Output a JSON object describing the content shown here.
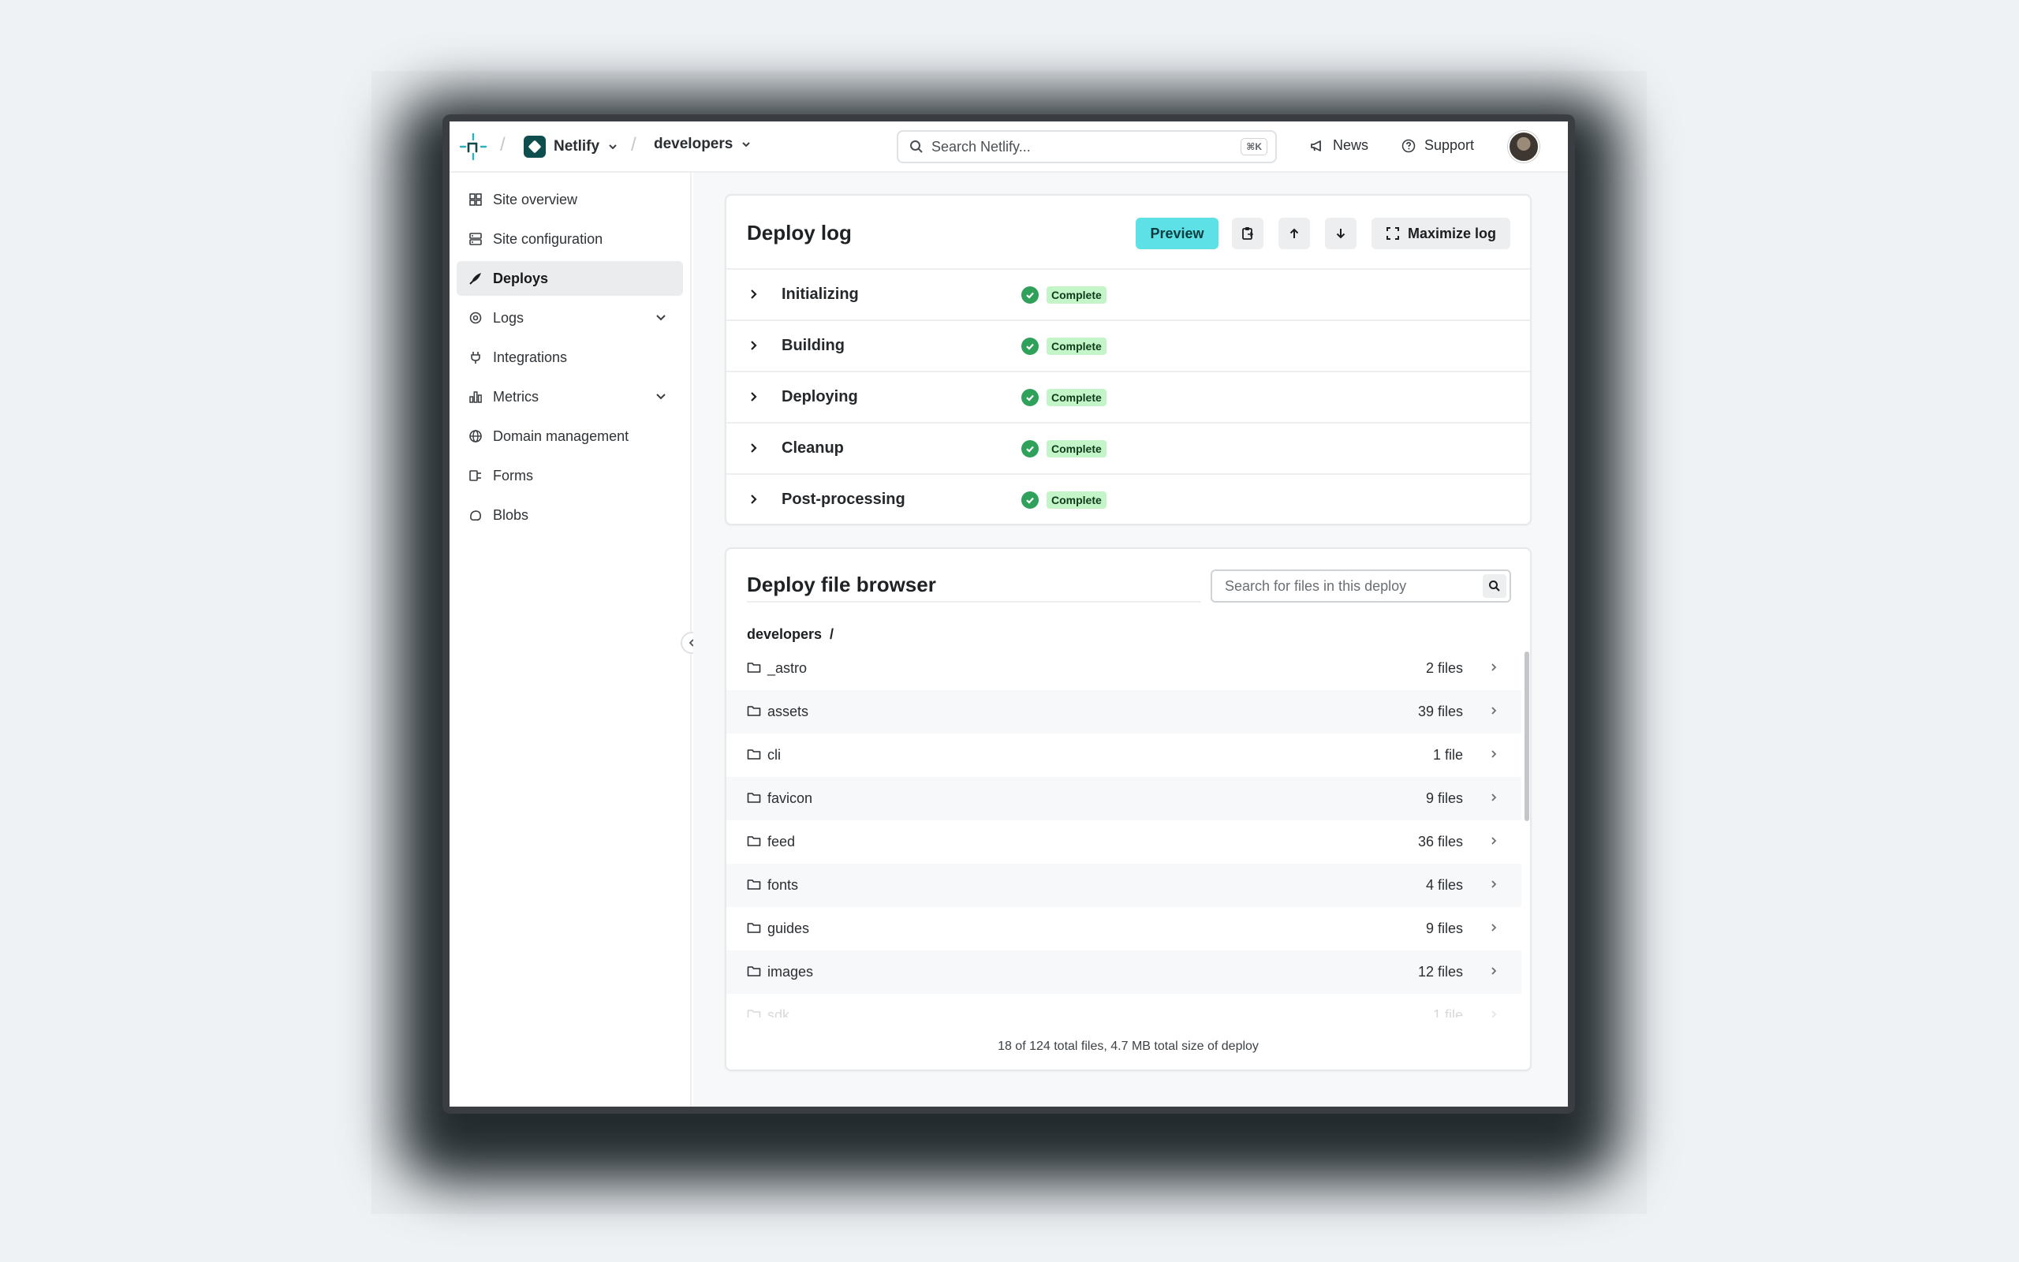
{
  "header": {
    "team_name": "Netlify",
    "site_name": "developers",
    "search_placeholder": "Search Netlify...",
    "search_shortcut": "⌘K",
    "news_label": "News",
    "support_label": "Support"
  },
  "sidebar": {
    "items": [
      {
        "label": "Site overview",
        "icon": "grid-icon"
      },
      {
        "label": "Site configuration",
        "icon": "config-icon"
      },
      {
        "label": "Deploys",
        "icon": "rocket-icon",
        "active": true
      },
      {
        "label": "Logs",
        "icon": "logs-icon",
        "expandable": true
      },
      {
        "label": "Integrations",
        "icon": "plug-icon"
      },
      {
        "label": "Metrics",
        "icon": "chart-icon",
        "expandable": true
      },
      {
        "label": "Domain management",
        "icon": "globe-icon"
      },
      {
        "label": "Forms",
        "icon": "form-icon"
      },
      {
        "label": "Blobs",
        "icon": "blob-icon"
      }
    ]
  },
  "deploy_log": {
    "title": "Deploy log",
    "preview_label": "Preview",
    "maximize_label": "Maximize log",
    "steps": [
      {
        "name": "Initializing",
        "status": "Complete"
      },
      {
        "name": "Building",
        "status": "Complete"
      },
      {
        "name": "Deploying",
        "status": "Complete"
      },
      {
        "name": "Cleanup",
        "status": "Complete"
      },
      {
        "name": "Post-processing",
        "status": "Complete"
      }
    ]
  },
  "file_browser": {
    "title": "Deploy file browser",
    "search_placeholder": "Search for files in this deploy",
    "breadcrumb": "developers  /",
    "files": [
      {
        "name": "_astro",
        "count": "2 files"
      },
      {
        "name": "assets",
        "count": "39 files"
      },
      {
        "name": "cli",
        "count": "1 file"
      },
      {
        "name": "favicon",
        "count": "9 files"
      },
      {
        "name": "feed",
        "count": "36 files"
      },
      {
        "name": "fonts",
        "count": "4 files"
      },
      {
        "name": "guides",
        "count": "9 files"
      },
      {
        "name": "images",
        "count": "12 files"
      },
      {
        "name": "sdk",
        "count": "1 file"
      }
    ],
    "footer": "18 of 124 total files, 4.7 MB total size of deploy"
  },
  "colors": {
    "accent": "#5de1e6",
    "success": "#2fa15a",
    "success_badge": "#c4f5c9",
    "brand_teal": "#0e4e4f"
  }
}
